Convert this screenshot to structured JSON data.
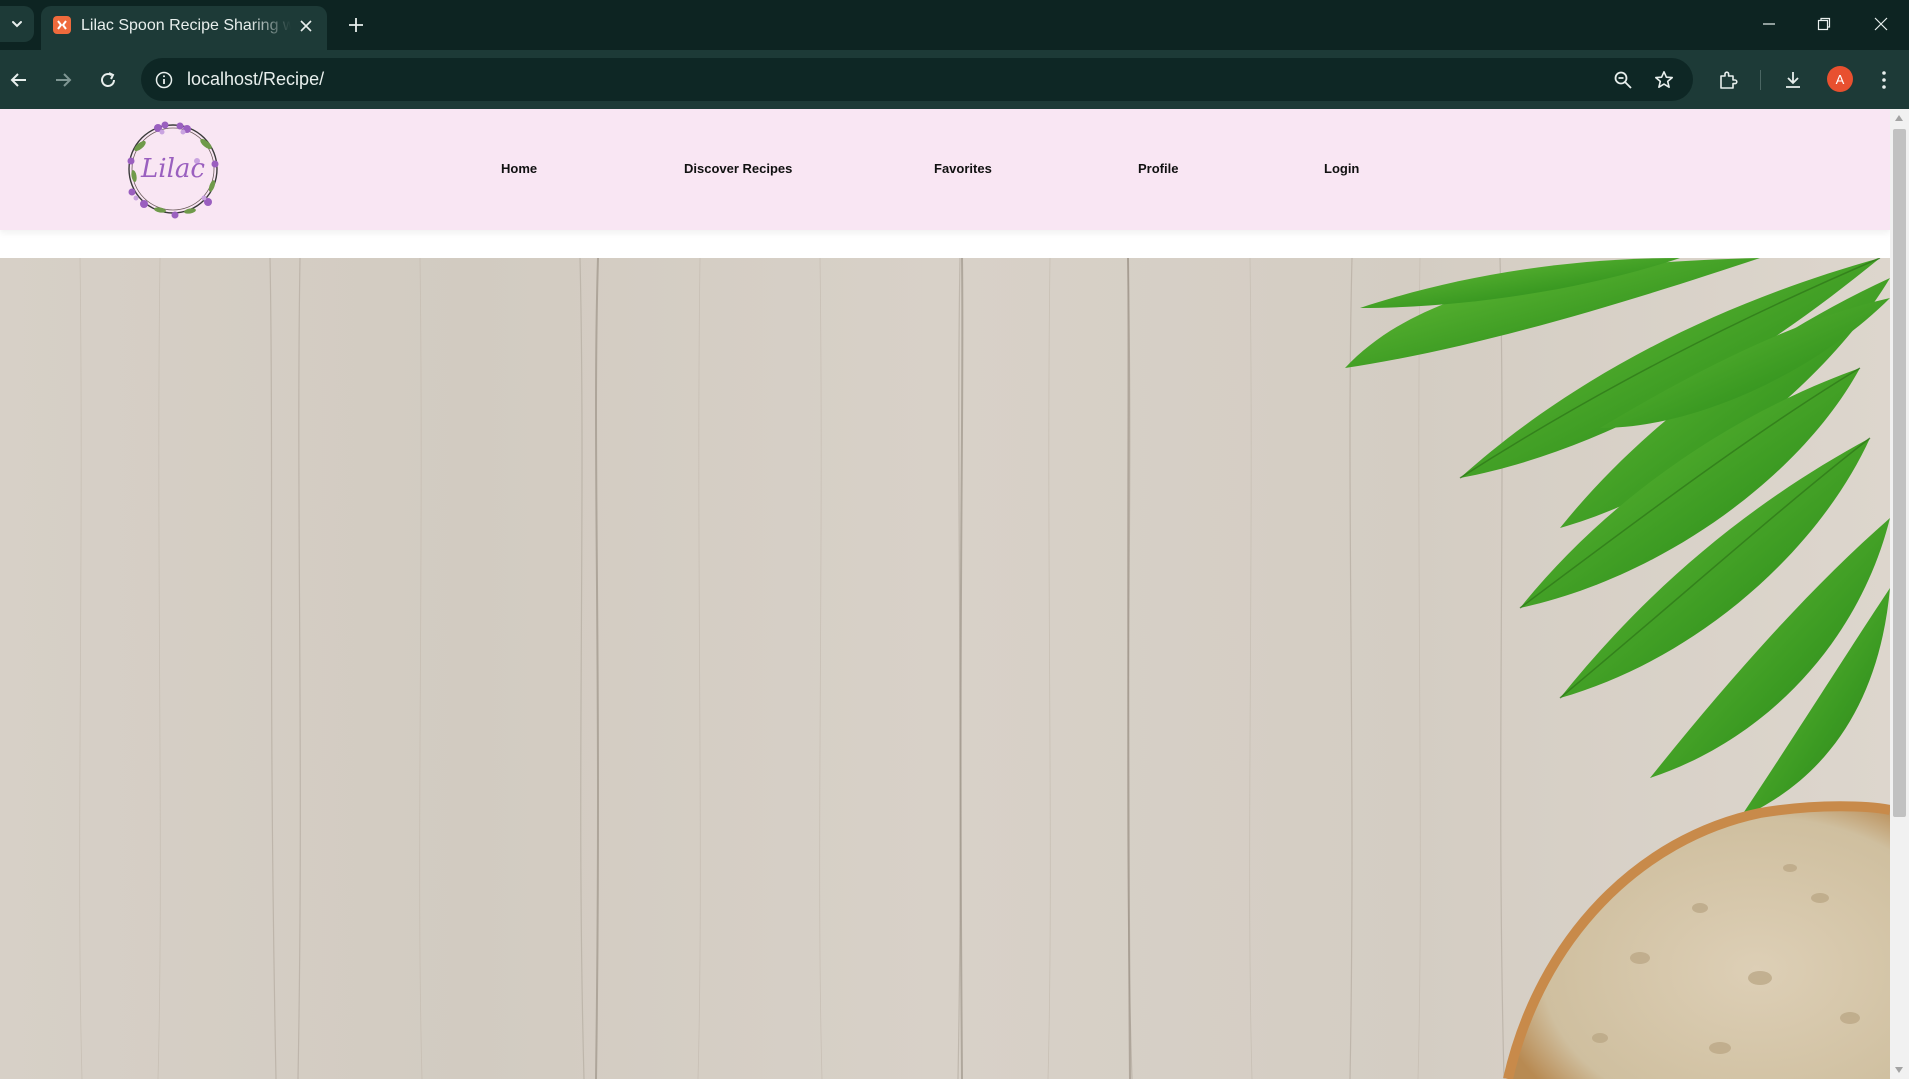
{
  "browser": {
    "tab_title": "Lilac Spoon Recipe Sharing website",
    "url": "localhost/Recipe/",
    "profile_initial": "A"
  },
  "site": {
    "logo_text": "Lilac",
    "nav": [
      {
        "label": "Home"
      },
      {
        "label": "Discover Recipes"
      },
      {
        "label": "Favorites"
      },
      {
        "label": "Profile"
      },
      {
        "label": "Login"
      }
    ]
  },
  "colors": {
    "browser_frame": "#0d2422",
    "toolbar": "#1d3a37",
    "header_bg": "#f9e6f3",
    "logo_purple": "#9a5fbf",
    "wood": "#d8d1c8",
    "leaf": "#3f9e24",
    "bread_crust": "#c88a4a"
  },
  "icons": {
    "tab_search": "chevron-down-icon",
    "favicon": "xampp-favicon-icon",
    "close": "close-icon",
    "new_tab": "plus-icon",
    "back": "arrow-left-icon",
    "forward": "arrow-right-icon",
    "reload": "reload-icon",
    "site_info": "info-icon",
    "zoom": "zoom-icon",
    "bookmark": "star-icon",
    "extensions": "puzzle-icon",
    "downloads": "download-icon",
    "menu": "kebab-menu-icon"
  }
}
